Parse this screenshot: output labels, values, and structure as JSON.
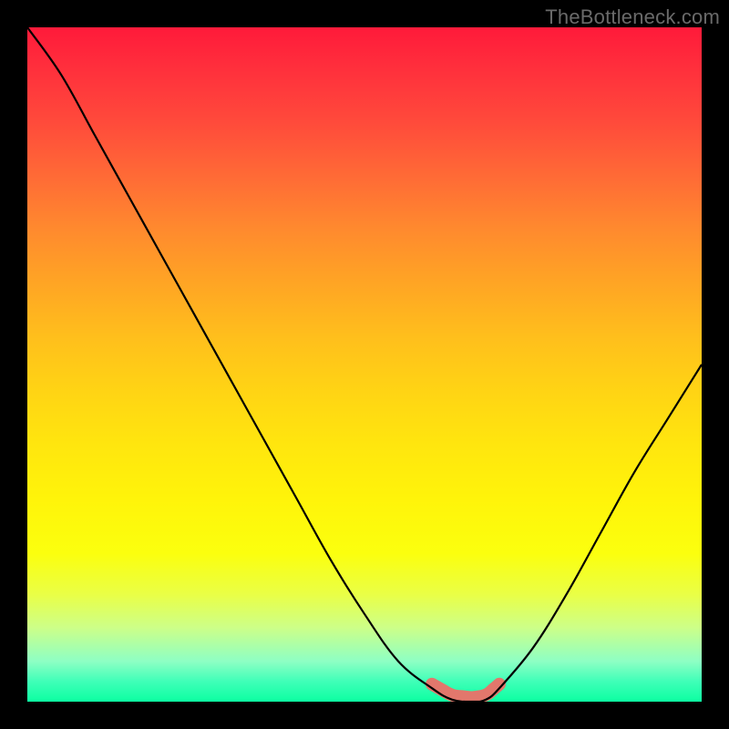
{
  "watermark": "TheBottleneck.com",
  "chart_data": {
    "type": "line",
    "title": "",
    "xlabel": "",
    "ylabel": "",
    "xlim": [
      0,
      100
    ],
    "ylim": [
      0,
      100
    ],
    "grid": false,
    "series": [
      {
        "name": "curve",
        "x": [
          0,
          5,
          10,
          15,
          20,
          25,
          30,
          35,
          40,
          45,
          50,
          55,
          60,
          63,
          66,
          68,
          70,
          75,
          80,
          85,
          90,
          95,
          100
        ],
        "y": [
          100,
          93,
          84,
          75,
          66,
          57,
          48,
          39,
          30,
          21,
          13,
          6,
          2,
          0.3,
          0,
          0.3,
          2,
          8,
          16,
          25,
          34,
          42,
          50
        ]
      }
    ],
    "highlight_range_x": [
      60,
      70
    ],
    "background_gradient": {
      "top": "#ff1a3a",
      "mid_upper": "#ffbf1c",
      "mid_lower": "#fff40a",
      "bottom": "#0cffa2"
    }
  }
}
